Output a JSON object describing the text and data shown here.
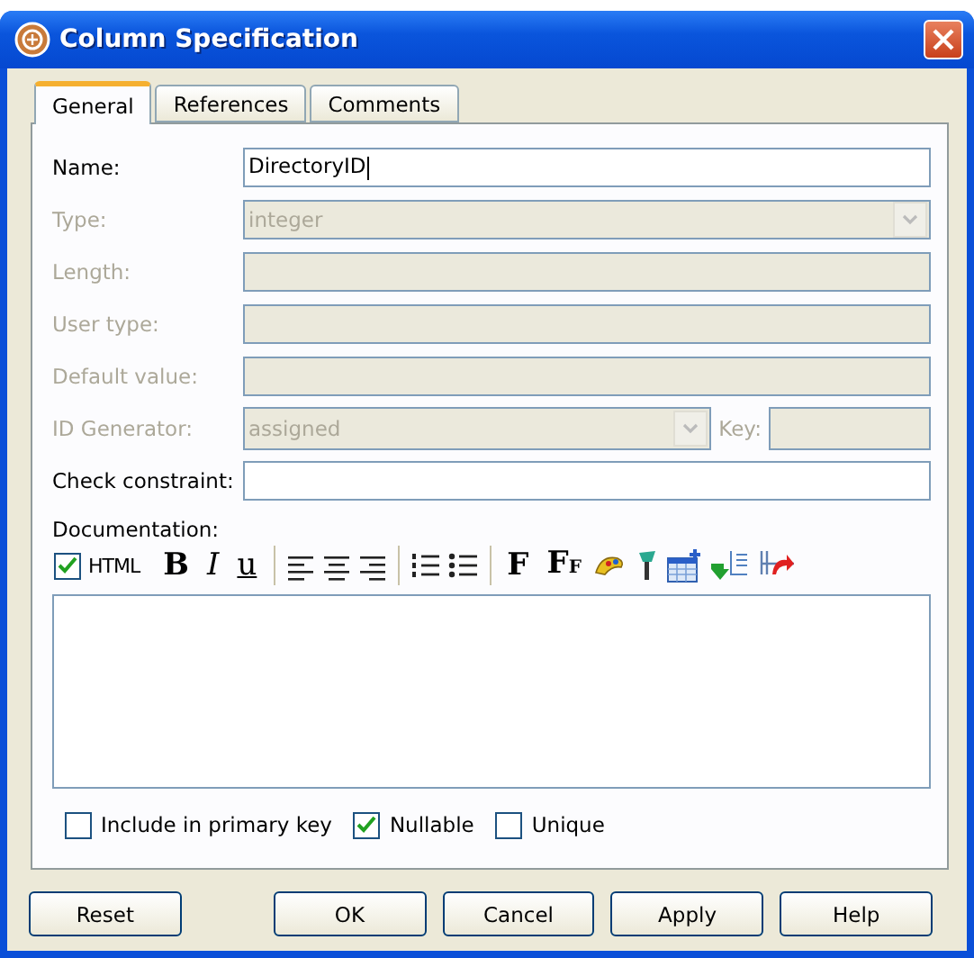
{
  "window": {
    "title": "Column Specification"
  },
  "tabs": [
    {
      "label": "General",
      "selected": true
    },
    {
      "label": "References",
      "selected": false
    },
    {
      "label": "Comments",
      "selected": false
    }
  ],
  "fields": [
    {
      "kind": "text",
      "label": "Name:",
      "value": "DirectoryID",
      "disabled": false
    },
    {
      "kind": "select",
      "label": "Type:",
      "value": "integer",
      "disabled": true
    },
    {
      "kind": "text",
      "label": "Length:",
      "disabled": true
    },
    {
      "kind": "text",
      "label": "User type:",
      "disabled": true
    },
    {
      "kind": "text",
      "label": "Default value:",
      "disabled": true
    },
    {
      "kind": "select_key",
      "label": "ID Generator:",
      "value": "assigned",
      "key_label": "Key:",
      "disabled": true
    },
    {
      "kind": "text",
      "label": "Check constraint:",
      "disabled": false
    }
  ],
  "documentation": {
    "label": "Documentation:",
    "html": {
      "label": "HTML",
      "checked": true
    },
    "toolbar": [
      {
        "kind": "bold",
        "text": "B"
      },
      {
        "kind": "italic",
        "text": "I"
      },
      {
        "kind": "underline",
        "text": "u"
      },
      {
        "kind": "sep"
      },
      {
        "kind": "align_left"
      },
      {
        "kind": "align_center"
      },
      {
        "kind": "align_right"
      },
      {
        "kind": "sep"
      },
      {
        "kind": "ordered_list"
      },
      {
        "kind": "bullet_list"
      },
      {
        "kind": "sep"
      },
      {
        "kind": "font",
        "text": "F"
      },
      {
        "kind": "font_size",
        "text": "F",
        "sub": "F"
      },
      {
        "kind": "color"
      },
      {
        "kind": "brush"
      },
      {
        "kind": "table"
      },
      {
        "kind": "insert_row"
      },
      {
        "kind": "delete_row"
      }
    ]
  },
  "options": [
    {
      "label": "Include in primary key",
      "checked": false
    },
    {
      "label": "Nullable",
      "checked": true
    },
    {
      "label": "Unique",
      "checked": false
    }
  ],
  "buttons": [
    {
      "label": "Reset"
    },
    {
      "label": "OK"
    },
    {
      "label": "Cancel"
    },
    {
      "label": "Apply"
    },
    {
      "label": "Help"
    }
  ]
}
